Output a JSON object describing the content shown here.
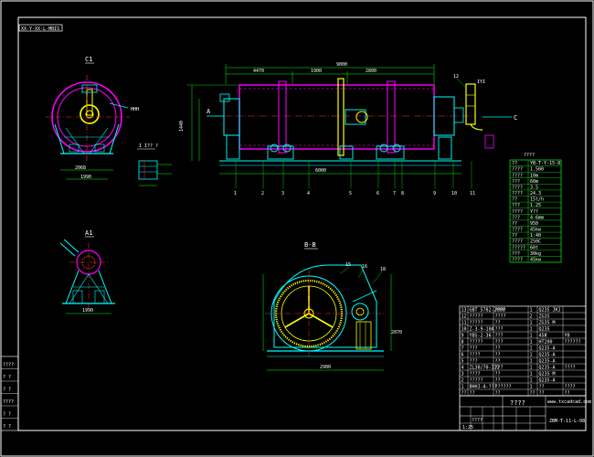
{
  "drawing": {
    "code_stamp": "XX-Y-XX-L-MBIS",
    "colors": {
      "background": "#000000",
      "frame": "#ffffff",
      "outline": "#00ffff",
      "dimension": "#00ff00",
      "center_line": "#ff3030",
      "shell": "#ff00ff",
      "accent": "#ffff00"
    }
  },
  "views": {
    "view_c_label": "C1",
    "view_a_label": "A1",
    "view_b_label": "B-B",
    "detail_label": "I I?? ?",
    "arrow_a": "A",
    "arrow_c": "C",
    "main_dims": {
      "overall": "9000",
      "left_span": "4470",
      "mid_span": "1900",
      "right_span": "2800",
      "base_len": "6000",
      "height": "1440",
      "view_c_base": "2068",
      "view_c_width": "1990",
      "view_a_base": "1990",
      "view_b_width": "2900",
      "view_b_height": "2070"
    },
    "part_balloons": [
      "1",
      "2",
      "3",
      "4",
      "5",
      "6",
      "7",
      "8",
      "9",
      "10",
      "11",
      "12"
    ],
    "inlet_label": "IYI",
    "view_c_tag": "HHH",
    "view_b_tags": [
      "15",
      "16",
      "18"
    ]
  },
  "spec_table": {
    "title": "????",
    "rows": [
      [
        "??",
        "YB-T-Y-15-8"
      ],
      [
        "????",
        "1.500"
      ],
      [
        "????",
        "10m"
      ],
      [
        "???",
        "60m"
      ],
      [
        "????",
        "3.5"
      ],
      [
        "????",
        "24.3"
      ],
      [
        "??",
        "15t/h"
      ],
      [
        "???",
        "1.25"
      ],
      [
        "????",
        "Y??"
      ],
      [
        "???",
        "4-6mm"
      ],
      [
        "??",
        "950"
      ],
      [
        "????",
        "45kw"
      ],
      [
        "??",
        "1:40"
      ],
      [
        "????",
        "250C"
      ],
      [
        "?????",
        "60t"
      ],
      [
        "???",
        "30kg"
      ],
      [
        "????",
        "45kw"
      ]
    ]
  },
  "bom": {
    "rows": [
      [
        "13",
        "GBT 5782-2000",
        "????",
        "1",
        "Q235 JKJ",
        ""
      ],
      [
        "12",
        "?????",
        "????",
        "2",
        "ZG35",
        ""
      ],
      [
        "11",
        "?????",
        "??",
        "1",
        "ZG35 M",
        ""
      ],
      [
        "10",
        "Z-3-9-10A",
        "???",
        "1",
        "Q235",
        ""
      ],
      [
        "9",
        "YBS-2-36",
        "???",
        "1",
        "45#",
        "Y0"
      ],
      [
        "8",
        "?????",
        "???",
        "1",
        "HT200",
        "??????"
      ],
      [
        "7",
        "???",
        "??",
        "1",
        "Q235-A",
        ""
      ],
      [
        "6",
        "????",
        "??",
        "1",
        "Q235-A",
        ""
      ],
      [
        "5",
        "???",
        "??",
        "1",
        "Q235-A",
        ""
      ],
      [
        "4",
        "ZL30/70-III",
        "???",
        "1",
        "Q235-A",
        "????"
      ],
      [
        "3",
        "????",
        "??",
        "1",
        "Q235 M",
        ""
      ],
      [
        "2",
        "?????",
        "??",
        "1",
        "Q235-A",
        ""
      ],
      [
        "1",
        "BHHJ-4-???",
        "??????",
        "1",
        "??",
        "????"
      ]
    ],
    "header": [
      "??",
      "??",
      "??",
      "??",
      "??",
      "??"
    ]
  },
  "title_block": {
    "title": "????",
    "site": "www.txcadcad.com",
    "drawing_no": "ZBM-T-11-L-08",
    "scale": "1:25",
    "sheet": "????"
  },
  "revision_block": {
    "rows": [
      "????",
      "? ?",
      "? ?",
      "????",
      "? ?",
      "? ?"
    ]
  }
}
